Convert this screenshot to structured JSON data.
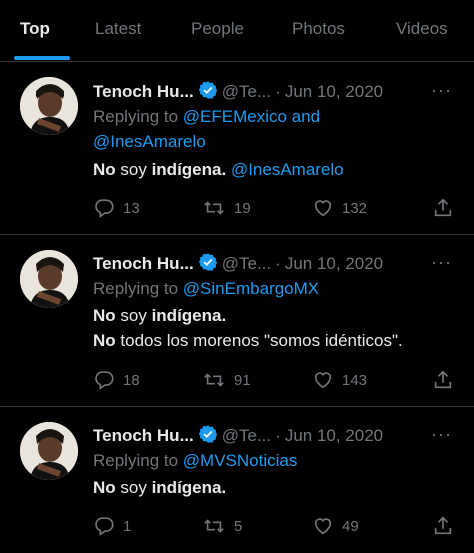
{
  "tabs": [
    "Top",
    "Latest",
    "People",
    "Photos",
    "Videos"
  ],
  "colors": {
    "accent": "#1d9bf0",
    "background": "#000000",
    "muted": "#71767b",
    "text": "#e7e9ea"
  },
  "tweets": [
    {
      "name": "Tenoch Hu...",
      "handle": "@Te...",
      "date": "Jun 10, 2020",
      "replying_prefix": "Replying to",
      "replying_to": [
        "@EFEMexico",
        "@InesAmarelo"
      ],
      "replying_joiner": "and",
      "body": [
        {
          "parts": [
            "No",
            " soy ",
            "indígena.",
            " ",
            "@InesAmarelo"
          ]
        }
      ],
      "replies": "13",
      "retweets": "19",
      "likes": "132"
    },
    {
      "name": "Tenoch Hu...",
      "handle": "@Te...",
      "date": "Jun 10, 2020",
      "replying_prefix": "Replying to",
      "replying_to": [
        "@SinEmbargoMX"
      ],
      "body": [
        {
          "parts": [
            "No",
            " soy ",
            "indígena."
          ]
        },
        {
          "parts": [
            "No",
            " todos los morenos \"somos idénticos\"."
          ]
        }
      ],
      "replies": "18",
      "retweets": "91",
      "likes": "143"
    },
    {
      "name": "Tenoch Hu...",
      "handle": "@Te...",
      "date": "Jun 10, 2020",
      "replying_prefix": "Replying to",
      "replying_to": [
        "@MVSNoticias"
      ],
      "body": [
        {
          "parts": [
            "No",
            " soy ",
            "indígena."
          ]
        }
      ],
      "replies": "1",
      "retweets": "5",
      "likes": "49"
    }
  ]
}
